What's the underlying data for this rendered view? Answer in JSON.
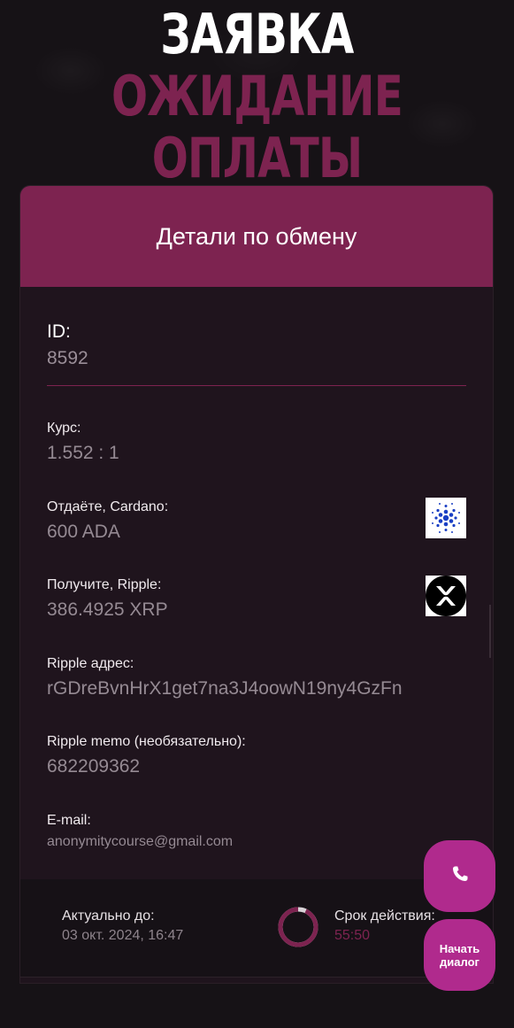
{
  "page_title": {
    "word1": "ЗАЯВКА",
    "word2": "ОЖИДАНИЕ",
    "word3": "ОПЛАТЫ"
  },
  "card": {
    "header": "Детали по обмену",
    "id_label": "ID:",
    "id_value": "8592",
    "rate_label": "Курс:",
    "rate_value": "1.552 : 1",
    "give_label": "Отдаёте, Cardano:",
    "give_value": "600 ADA",
    "receive_label": "Получите, Ripple:",
    "receive_value": "386.4925 XRP",
    "address_label": "Ripple адрес:",
    "address_value": "rGDreBvnHrX1get7na3J4oowN19ny4GzFn",
    "memo_label": "Ripple memo (необязательно):",
    "memo_value": "682209362",
    "email_label": "E-mail:",
    "email_value": "anonymitycourse@gmail.com"
  },
  "footer": {
    "valid_until_label": "Актуально до:",
    "valid_until_value": "03 окт. 2024, 16:47",
    "term_label": "Срок действия:",
    "term_value": "55:50",
    "timer_remaining_fraction": 0.93
  },
  "buttons": {
    "chat_label_line1": "Начать",
    "chat_label_line2": "диалог"
  },
  "icons": {
    "give_coin": "cardano-icon",
    "receive_coin": "ripple-icon",
    "call": "phone-icon"
  },
  "colors": {
    "accent": "#7d2350",
    "fab": "#b02a8d",
    "background": "#161216",
    "card": "#1f141d"
  }
}
